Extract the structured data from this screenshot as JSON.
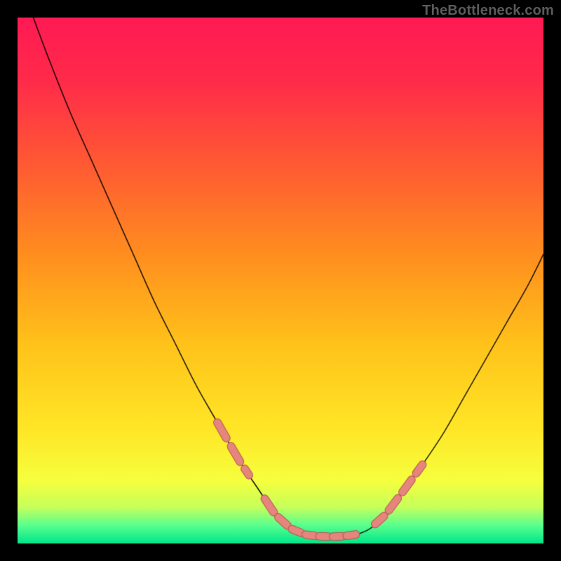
{
  "watermark": "TheBottleneck.com",
  "colors": {
    "frame": "#000000",
    "gradient_stops": [
      {
        "pos": 0.0,
        "color": "#ff1a53"
      },
      {
        "pos": 0.12,
        "color": "#ff2b4a"
      },
      {
        "pos": 0.28,
        "color": "#ff5a33"
      },
      {
        "pos": 0.45,
        "color": "#ff8e1f"
      },
      {
        "pos": 0.62,
        "color": "#ffc21a"
      },
      {
        "pos": 0.78,
        "color": "#ffe626"
      },
      {
        "pos": 0.88,
        "color": "#f6ff3e"
      },
      {
        "pos": 0.93,
        "color": "#c8ff5a"
      },
      {
        "pos": 0.965,
        "color": "#5bff8e"
      },
      {
        "pos": 1.0,
        "color": "#00e68a"
      }
    ],
    "curve": "#000000",
    "marker_fill": "#e6847e",
    "marker_stroke": "#b3564f"
  },
  "chart_data": {
    "type": "line",
    "title": "",
    "xlabel": "",
    "ylabel": "",
    "axes_visible": false,
    "grid": false,
    "xlim": [
      0,
      100
    ],
    "ylim": [
      0,
      100
    ],
    "series": [
      {
        "name": "bottleneck-curve",
        "comment": "Decorative V-shaped curve. x/y in percent of plot area; y=0 is BOTTOM, y=100 is TOP. Values are estimated from pixels.",
        "x": [
          3,
          6,
          10,
          14,
          18,
          22,
          26,
          30,
          34,
          38,
          42,
          46,
          49,
          52,
          55,
          58,
          61,
          64,
          67,
          70,
          73,
          77,
          81,
          85,
          89,
          93,
          97,
          100
        ],
        "y": [
          100,
          92,
          82,
          73,
          64,
          55,
          46,
          38,
          30,
          23,
          16,
          10,
          5.5,
          2.8,
          1.6,
          1.3,
          1.3,
          1.6,
          2.8,
          5.5,
          9.5,
          15,
          21,
          28,
          35,
          42,
          49,
          55
        ]
      }
    ],
    "markers": {
      "comment": "Salmon dashed overlay segments on the curve near the valley.",
      "segments": [
        {
          "x_start": 38,
          "x_end": 44
        },
        {
          "x_start": 47,
          "x_end": 65
        },
        {
          "x_start": 68,
          "x_end": 77
        }
      ],
      "dash_len_pct": 1.7,
      "gap_pct": 0.9,
      "radius_px": 5
    }
  }
}
